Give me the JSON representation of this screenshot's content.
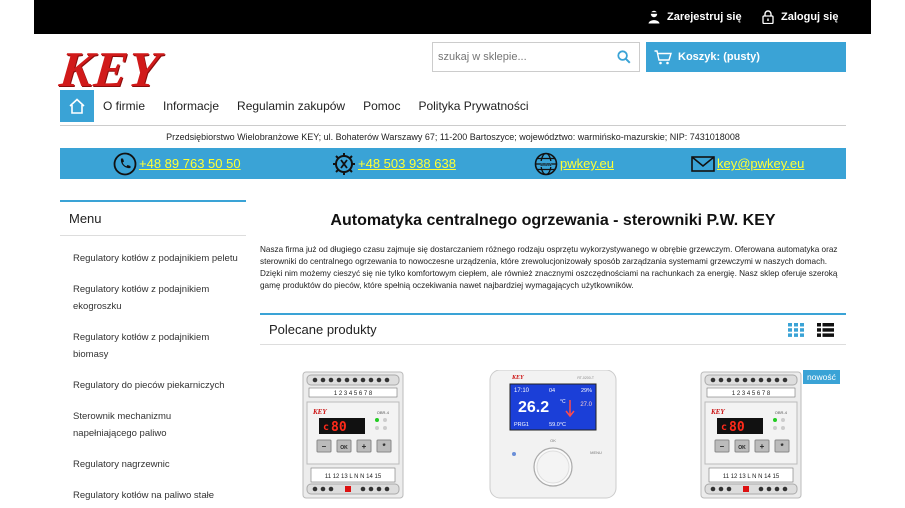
{
  "account": {
    "register_label": "Zarejestruj się",
    "login_label": "Zaloguj się"
  },
  "logo": {
    "text": "KEY"
  },
  "search": {
    "placeholder": "szukaj w sklepie..."
  },
  "cart": {
    "label": "Koszyk: (pusty)"
  },
  "nav": {
    "items": [
      "O firmie",
      "Informacje",
      "Regulamin zakupów",
      "Pomoc",
      "Polityka Prywatności"
    ]
  },
  "company_line": "Przedsiębiorstwo Wielobranżowe KEY; ul. Bohaterów Warszawy 67; 11-200 Bartoszyce; województwo: warmińsko-mazurskie; NIP: 7431018008",
  "contact": {
    "phone": "+48 89 763 50 50",
    "mobile": "+48 503 938 638",
    "website": "pwkey.eu",
    "email": "key@pwkey.eu"
  },
  "sidebar": {
    "title": "Menu",
    "items": [
      "Regulatory kotłów z podajnikiem peletu",
      "Regulatory kotłów z podajnikiem ekogroszku",
      "Regulatory kotłów z podajnikiem biomasy",
      "Regulatory do pieców piekarniczych",
      "Sterownik mechanizmu napełniającego paliwo",
      "Regulatory nagrzewnic",
      "Regulatory kotłów na paliwo stałe"
    ]
  },
  "main": {
    "title": "Automatyka centralnego ogrzewania - sterowniki P.W. KEY",
    "description": "Nasza firma już od długiego czasu zajmuje się dostarczaniem różnego rodzaju osprzętu wykorzystywanego w obrębie grzewczym. Oferowana automatyka oraz sterowniki do centralnego ogrzewania to nowoczesne urządzenia, które zrewolucjonizowały sposób zarządzania systemami grzewczymi w naszych domach. Dzięki nim możemy cieszyć się nie tylko komfortowym ciepłem, ale również znacznymi oszczędnościami na rachunkach za energię. Nasz sklep oferuje szeroką gamę produktów do pieców, które spełnią oczekiwania nawet najbardziej wymagających użytkowników."
  },
  "recommended": {
    "title": "Polecane produkty",
    "badge_new": "nowość",
    "products": [
      {
        "icon": "din-rail-controller-image",
        "display": "80",
        "brand": "KEY",
        "model": "OBR-4",
        "keys": [
          "–",
          "OK",
          "+",
          "*"
        ]
      },
      {
        "icon": "wall-room-controller-image",
        "brand": "KEY",
        "model": "RT-0200-T",
        "time": "17:10",
        "day": "04",
        "humidity": "29%",
        "temp_main": "26.2",
        "temp_unit": "°C",
        "temp_small": "27.0",
        "prog": "PRG1",
        "temp_bottom": "59.0°C",
        "ok": "OK",
        "menu": "MENU"
      },
      {
        "icon": "din-rail-controller-image",
        "display": "80",
        "brand": "KEY",
        "model": "OBR-4",
        "keys": [
          "–",
          "OK",
          "+",
          "*"
        ]
      }
    ]
  },
  "colors": {
    "accent": "#3aa3d6",
    "logo_red": "#d11a1a",
    "contact_link": "#ffff33",
    "topbar": "#000000"
  }
}
